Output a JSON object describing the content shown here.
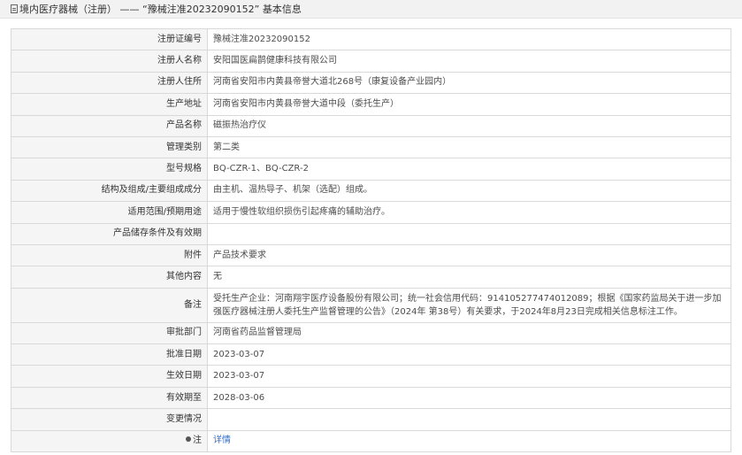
{
  "header": {
    "icon": "document-icon",
    "title": "境内医疗器械（注册） —— “豫械注准20232090152” 基本信息"
  },
  "rows": [
    {
      "label": "注册证编号",
      "value": "豫械注准20232090152"
    },
    {
      "label": "注册人名称",
      "value": "安阳国医扁鹊健康科技有限公司"
    },
    {
      "label": "注册人住所",
      "value": "河南省安阳市内黄县帝誉大道北268号（康复设备产业园内）"
    },
    {
      "label": "生产地址",
      "value": "河南省安阳市内黄县帝誉大道中段（委托生产）"
    },
    {
      "label": "产品名称",
      "value": "磁振热治疗仪"
    },
    {
      "label": "管理类别",
      "value": "第二类"
    },
    {
      "label": "型号规格",
      "value": "BQ-CZR-1、BQ-CZR-2"
    },
    {
      "label": "结构及组成/主要组成成分",
      "value": "由主机、温热导子、机架（选配）组成。"
    },
    {
      "label": "适用范围/预期用途",
      "value": "适用于慢性软组织损伤引起疼痛的辅助治疗。"
    },
    {
      "label": "产品储存条件及有效期",
      "value": ""
    },
    {
      "label": "附件",
      "value": "产品技术要求"
    },
    {
      "label": "其他内容",
      "value": "无"
    },
    {
      "label": "备注",
      "value": "受托生产企业：河南翔宇医疗设备股份有限公司；统一社会信用代码：914105277474012089；根据《国家药监局关于进一步加强医疗器械注册人委托生产监督管理的公告》（2024年 第38号）有关要求，于2024年8月23日完成相关信息标注工作。"
    },
    {
      "label": "审批部门",
      "value": "河南省药品监督管理局"
    },
    {
      "label": "批准日期",
      "value": "2023-03-07"
    },
    {
      "label": "生效日期",
      "value": "2023-03-07"
    },
    {
      "label": "有效期至",
      "value": "2028-03-06"
    },
    {
      "label": "变更情况",
      "value": ""
    }
  ],
  "note_row": {
    "icon": "bulb-icon",
    "label": "注",
    "link_text": "详情"
  },
  "colors": {
    "label_bg": "#f5f5f5",
    "border": "#d9d9d9",
    "link": "#2f6fd1",
    "header_bg": "#f2f2f2"
  }
}
